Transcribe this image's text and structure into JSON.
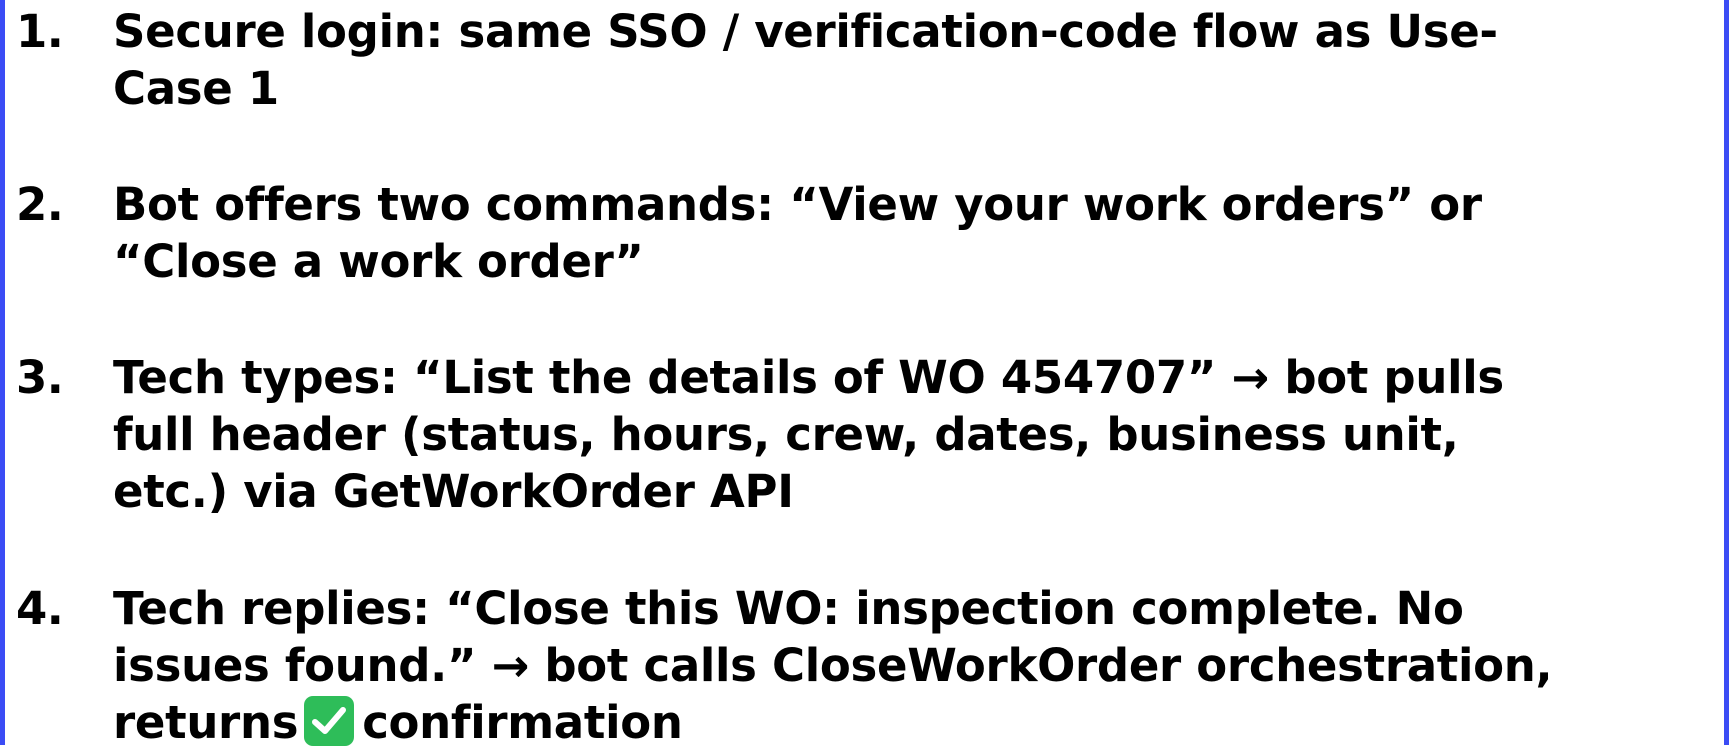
{
  "steps": [
    {
      "number": "1.",
      "lines": [
        "Secure login: same SSO / verification-code flow as Use-",
        "Case 1"
      ]
    },
    {
      "number": "2.",
      "lines": [
        "Bot offers two commands: “View your work orders” or",
        "“Close a work order”"
      ]
    },
    {
      "number": "3.",
      "lines": [
        "Tech types: “List the details of WO 454707” → bot pulls",
        "full header (status, hours, crew, dates, business unit,",
        "etc.) via GetWorkOrder API"
      ]
    },
    {
      "number": "4.",
      "lines": [
        "Tech replies: “Close this WO: inspection complete. No",
        "issues found.” → bot calls CloseWorkOrder orchestration,"
      ],
      "last_line_before_icon": "returns",
      "last_line_after_icon": "confirmation",
      "icon": "check-mark-icon"
    }
  ],
  "colors": {
    "frame_edge": "#3b4cf5",
    "check_icon_bg": "#2ebd59",
    "text": "#000000"
  }
}
